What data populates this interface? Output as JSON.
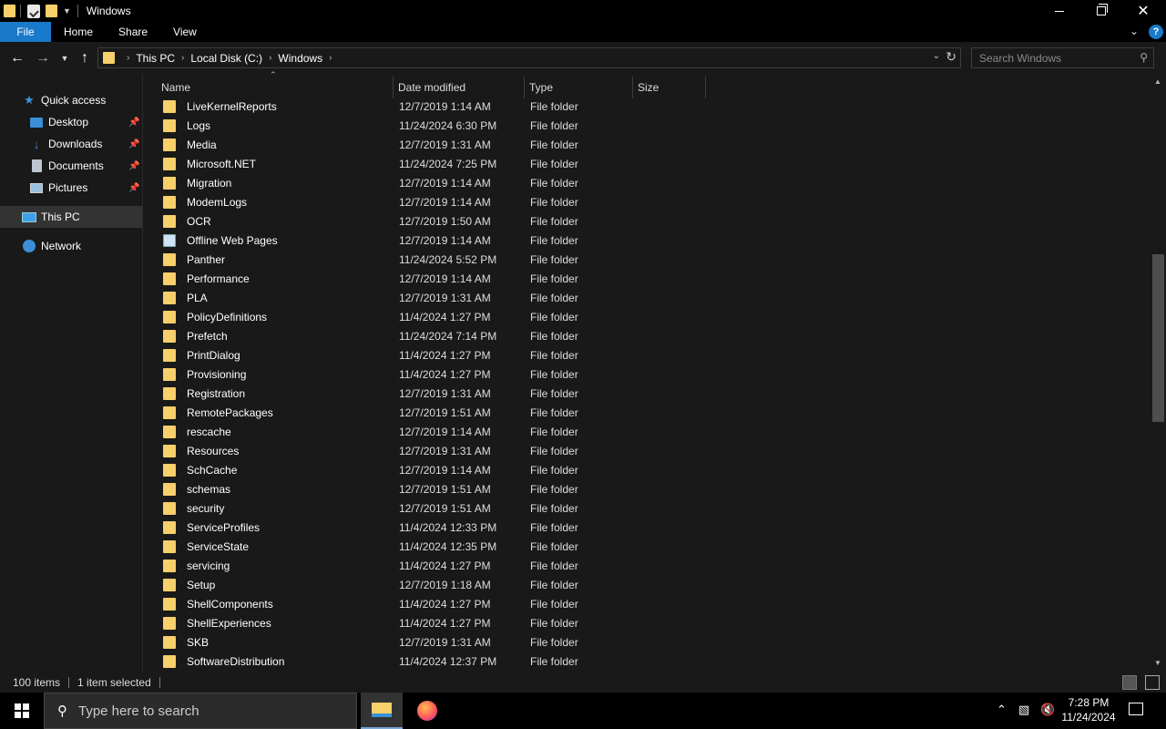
{
  "window": {
    "title": "Windows"
  },
  "ribbon": {
    "tabs": [
      {
        "label": "File"
      },
      {
        "label": "Home"
      },
      {
        "label": "Share"
      },
      {
        "label": "View"
      }
    ]
  },
  "address": {
    "crumbs": [
      "This PC",
      "Local Disk (C:)",
      "Windows"
    ]
  },
  "search": {
    "placeholder": "Search Windows"
  },
  "sidebar": {
    "quick_access": "Quick access",
    "items": [
      {
        "label": "Desktop"
      },
      {
        "label": "Downloads"
      },
      {
        "label": "Documents"
      },
      {
        "label": "Pictures"
      }
    ],
    "this_pc": "This PC",
    "network": "Network"
  },
  "columns": {
    "name": "Name",
    "date": "Date modified",
    "type": "Type",
    "size": "Size"
  },
  "files": [
    {
      "name": "LiveKernelReports",
      "date": "12/7/2019 1:14 AM",
      "type": "File folder"
    },
    {
      "name": "Logs",
      "date": "11/24/2024 6:30 PM",
      "type": "File folder"
    },
    {
      "name": "Media",
      "date": "12/7/2019 1:31 AM",
      "type": "File folder"
    },
    {
      "name": "Microsoft.NET",
      "date": "11/24/2024 7:25 PM",
      "type": "File folder"
    },
    {
      "name": "Migration",
      "date": "12/7/2019 1:14 AM",
      "type": "File folder"
    },
    {
      "name": "ModemLogs",
      "date": "12/7/2019 1:14 AM",
      "type": "File folder"
    },
    {
      "name": "OCR",
      "date": "12/7/2019 1:50 AM",
      "type": "File folder"
    },
    {
      "name": "Offline Web Pages",
      "date": "12/7/2019 1:14 AM",
      "type": "File folder",
      "special": true
    },
    {
      "name": "Panther",
      "date": "11/24/2024 5:52 PM",
      "type": "File folder"
    },
    {
      "name": "Performance",
      "date": "12/7/2019 1:14 AM",
      "type": "File folder"
    },
    {
      "name": "PLA",
      "date": "12/7/2019 1:31 AM",
      "type": "File folder"
    },
    {
      "name": "PolicyDefinitions",
      "date": "11/4/2024 1:27 PM",
      "type": "File folder"
    },
    {
      "name": "Prefetch",
      "date": "11/24/2024 7:14 PM",
      "type": "File folder"
    },
    {
      "name": "PrintDialog",
      "date": "11/4/2024 1:27 PM",
      "type": "File folder"
    },
    {
      "name": "Provisioning",
      "date": "11/4/2024 1:27 PM",
      "type": "File folder"
    },
    {
      "name": "Registration",
      "date": "12/7/2019 1:31 AM",
      "type": "File folder"
    },
    {
      "name": "RemotePackages",
      "date": "12/7/2019 1:51 AM",
      "type": "File folder"
    },
    {
      "name": "rescache",
      "date": "12/7/2019 1:14 AM",
      "type": "File folder"
    },
    {
      "name": "Resources",
      "date": "12/7/2019 1:31 AM",
      "type": "File folder"
    },
    {
      "name": "SchCache",
      "date": "12/7/2019 1:14 AM",
      "type": "File folder"
    },
    {
      "name": "schemas",
      "date": "12/7/2019 1:51 AM",
      "type": "File folder"
    },
    {
      "name": "security",
      "date": "12/7/2019 1:51 AM",
      "type": "File folder"
    },
    {
      "name": "ServiceProfiles",
      "date": "11/4/2024 12:33 PM",
      "type": "File folder"
    },
    {
      "name": "ServiceState",
      "date": "11/4/2024 12:35 PM",
      "type": "File folder"
    },
    {
      "name": "servicing",
      "date": "11/4/2024 1:27 PM",
      "type": "File folder"
    },
    {
      "name": "Setup",
      "date": "12/7/2019 1:18 AM",
      "type": "File folder"
    },
    {
      "name": "ShellComponents",
      "date": "11/4/2024 1:27 PM",
      "type": "File folder"
    },
    {
      "name": "ShellExperiences",
      "date": "11/4/2024 1:27 PM",
      "type": "File folder"
    },
    {
      "name": "SKB",
      "date": "12/7/2019 1:31 AM",
      "type": "File folder"
    },
    {
      "name": "SoftwareDistribution",
      "date": "11/4/2024 12:37 PM",
      "type": "File folder"
    }
  ],
  "status": {
    "count": "100 items",
    "selected": "1 item selected"
  },
  "taskbar": {
    "search_placeholder": "Type here to search",
    "time": "7:28 PM",
    "date": "11/24/2024"
  },
  "icons": {
    "folder": "folder-icon",
    "accent": "#1979ca",
    "folder_color": "#f7cf6b"
  }
}
